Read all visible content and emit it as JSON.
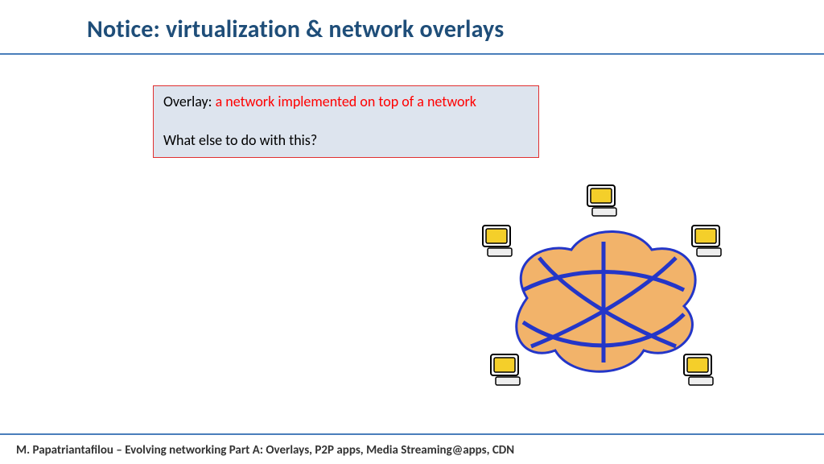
{
  "title": "Notice: virtualization & network overlays",
  "definition": {
    "label": "Overlay:",
    "meaning": "a network implemented on top of a network",
    "question": "What else to do with this?"
  },
  "diagram_alt": "network-overlay-illustration",
  "footer": "M. Papatriantafilou –  Evolving networking Part A: Overlays, P2P apps, Media Streaming@apps, CDN"
}
